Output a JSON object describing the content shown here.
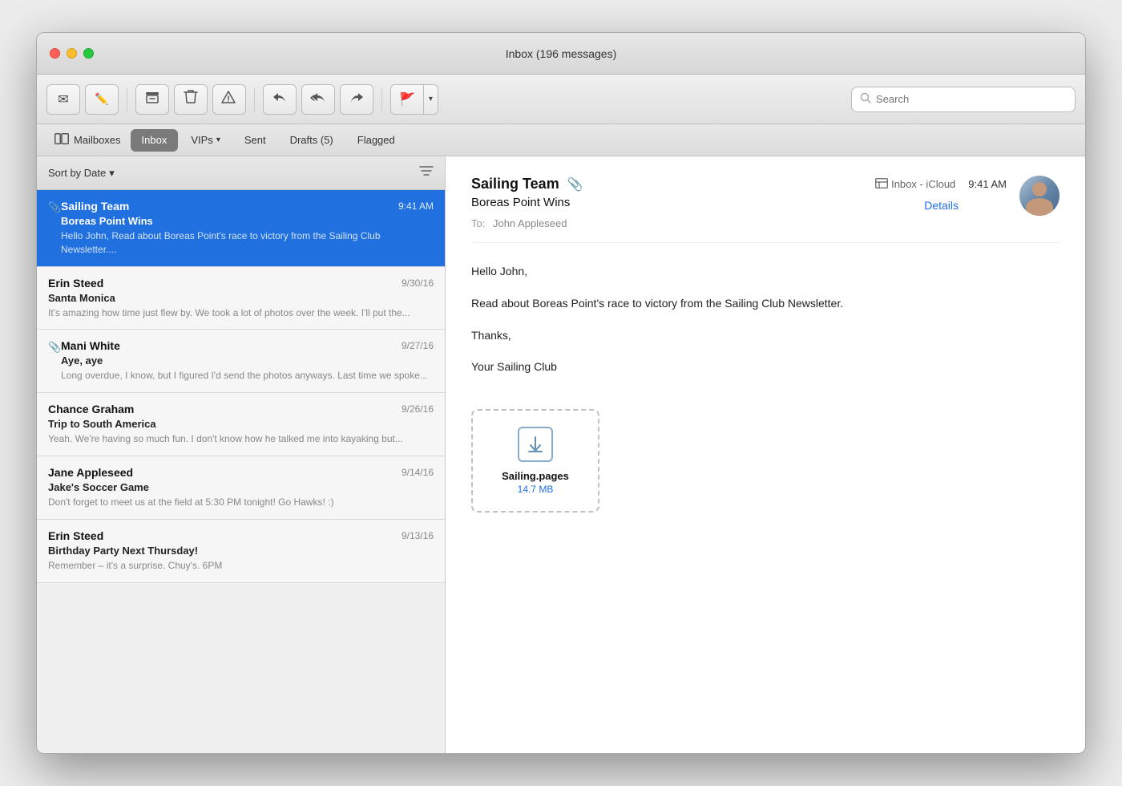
{
  "window": {
    "title": "Inbox (196 messages)"
  },
  "toolbar": {
    "new_message_icon": "✉",
    "compose_icon": "✏",
    "archive_icon": "🗂",
    "delete_icon": "🗑",
    "flag_junk_icon": "👎",
    "reply_icon": "↩",
    "reply_all_icon": "↩↩",
    "forward_icon": "→",
    "flag_icon": "🚩",
    "dropdown_icon": "▾",
    "search_placeholder": "Search"
  },
  "tabs": [
    {
      "id": "mailboxes",
      "label": "Mailboxes",
      "active": false
    },
    {
      "id": "inbox",
      "label": "Inbox",
      "active": true
    },
    {
      "id": "vips",
      "label": "VIPs",
      "active": false,
      "has_dropdown": true
    },
    {
      "id": "sent",
      "label": "Sent",
      "active": false
    },
    {
      "id": "drafts",
      "label": "Drafts (5)",
      "active": false
    },
    {
      "id": "flagged",
      "label": "Flagged",
      "active": false
    }
  ],
  "message_list": {
    "sort_label": "Sort by Date",
    "sort_chevron": "▾",
    "messages": [
      {
        "id": "msg1",
        "sender": "Sailing Team",
        "time": "9:41 AM",
        "subject": "Boreas Point Wins",
        "preview": "Hello John, Read about Boreas Point's race to victory from the Sailing Club Newsletter....",
        "has_attachment": true,
        "selected": true
      },
      {
        "id": "msg2",
        "sender": "Erin Steed",
        "time": "9/30/16",
        "subject": "Santa Monica",
        "preview": "It's amazing how time just flew by. We took a lot of photos over the week. I'll put the...",
        "has_attachment": false,
        "selected": false
      },
      {
        "id": "msg3",
        "sender": "Mani White",
        "time": "9/27/16",
        "subject": "Aye, aye",
        "preview": "Long overdue, I know, but I figured I'd send the photos anyways. Last time we spoke...",
        "has_attachment": true,
        "selected": false
      },
      {
        "id": "msg4",
        "sender": "Chance Graham",
        "time": "9/26/16",
        "subject": "Trip to South America",
        "preview": "Yeah. We're having so much fun. I don't know how he talked me into kayaking but...",
        "has_attachment": false,
        "selected": false
      },
      {
        "id": "msg5",
        "sender": "Jane Appleseed",
        "time": "9/14/16",
        "subject": "Jake's Soccer Game",
        "preview": "Don't forget to meet us at the field at 5:30 PM tonight! Go Hawks! :)",
        "has_attachment": false,
        "selected": false
      },
      {
        "id": "msg6",
        "sender": "Erin Steed",
        "time": "9/13/16",
        "subject": "Birthday Party Next Thursday!",
        "preview": "Remember – it's a surprise. Chuy's. 6PM",
        "has_attachment": false,
        "selected": false
      }
    ]
  },
  "detail": {
    "from": "Sailing Team",
    "subject": "Boreas Point Wins",
    "to_label": "To:",
    "to": "John Appleseed",
    "time": "9:41 AM",
    "inbox_label": "Inbox - iCloud",
    "details_link": "Details",
    "body_lines": [
      "Hello John,",
      "Read about Boreas Point's race to victory from the Sailing Club Newsletter.",
      "Thanks,",
      "Your Sailing Club"
    ],
    "attachment": {
      "name": "Sailing.pages",
      "size": "14.7 MB"
    }
  }
}
